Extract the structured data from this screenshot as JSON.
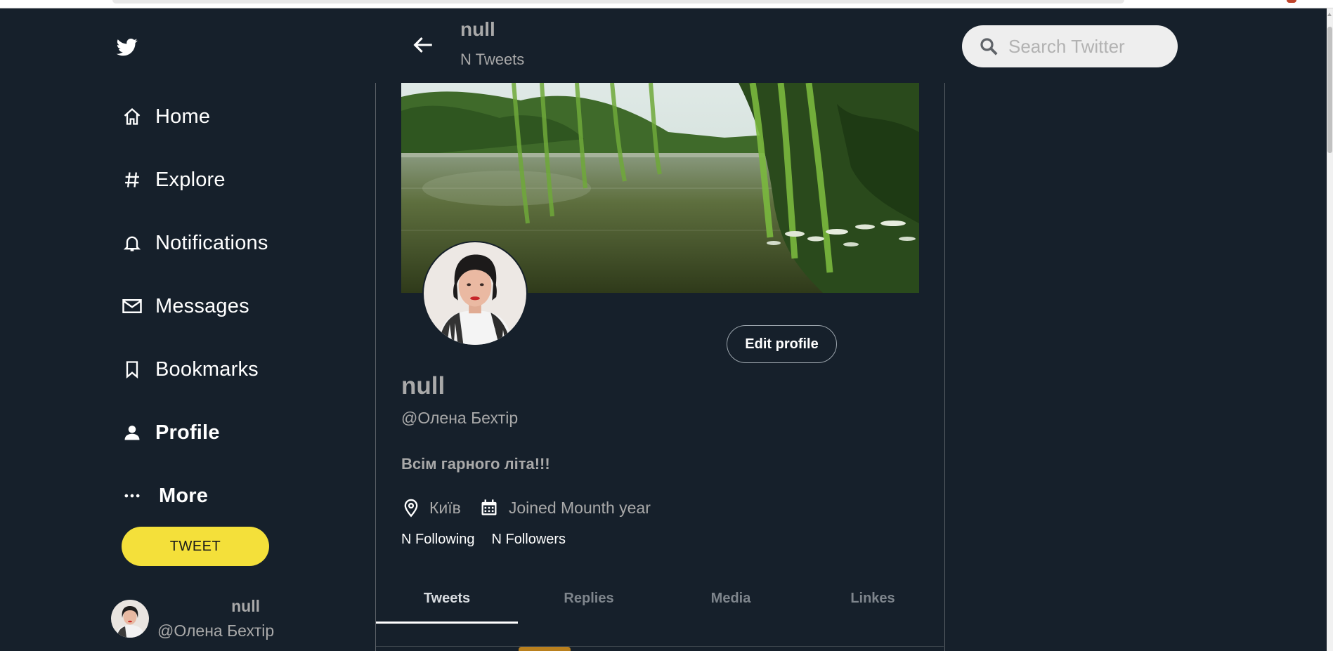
{
  "sidebar": {
    "logo_icon": "twitter-bird-icon",
    "items": [
      {
        "label": "Home",
        "icon": "home-icon"
      },
      {
        "label": "Explore",
        "icon": "hashtag-icon"
      },
      {
        "label": "Notifications",
        "icon": "bell-icon"
      },
      {
        "label": "Messages",
        "icon": "mail-icon"
      },
      {
        "label": "Bookmarks",
        "icon": "bookmark-icon"
      },
      {
        "label": "Profile",
        "icon": "person-icon",
        "active": true
      },
      {
        "label": "More",
        "icon": "more-dots-icon"
      }
    ],
    "tweet_button": "TWEET",
    "account": {
      "name": "null",
      "handle": "@Олена Бехтір"
    }
  },
  "header": {
    "title": "null",
    "subtitle": "N Tweets"
  },
  "search": {
    "placeholder": "Search Twitter"
  },
  "profile": {
    "edit_button": "Edit profile",
    "name": "null",
    "handle": "@Олена Бехтір",
    "bio": "Всім гарного літа!!!",
    "location": "Київ",
    "joined": "Joined Mounth year",
    "following": "N Following",
    "followers": "N Followers"
  },
  "tabs": [
    {
      "label": "Tweets",
      "active": true
    },
    {
      "label": "Replies"
    },
    {
      "label": "Media"
    },
    {
      "label": "Linkes"
    }
  ],
  "colors": {
    "background": "#16202b",
    "accent_yellow": "#f4e03a",
    "muted_text": "#a9a9a9",
    "divider": "#5a6066"
  }
}
